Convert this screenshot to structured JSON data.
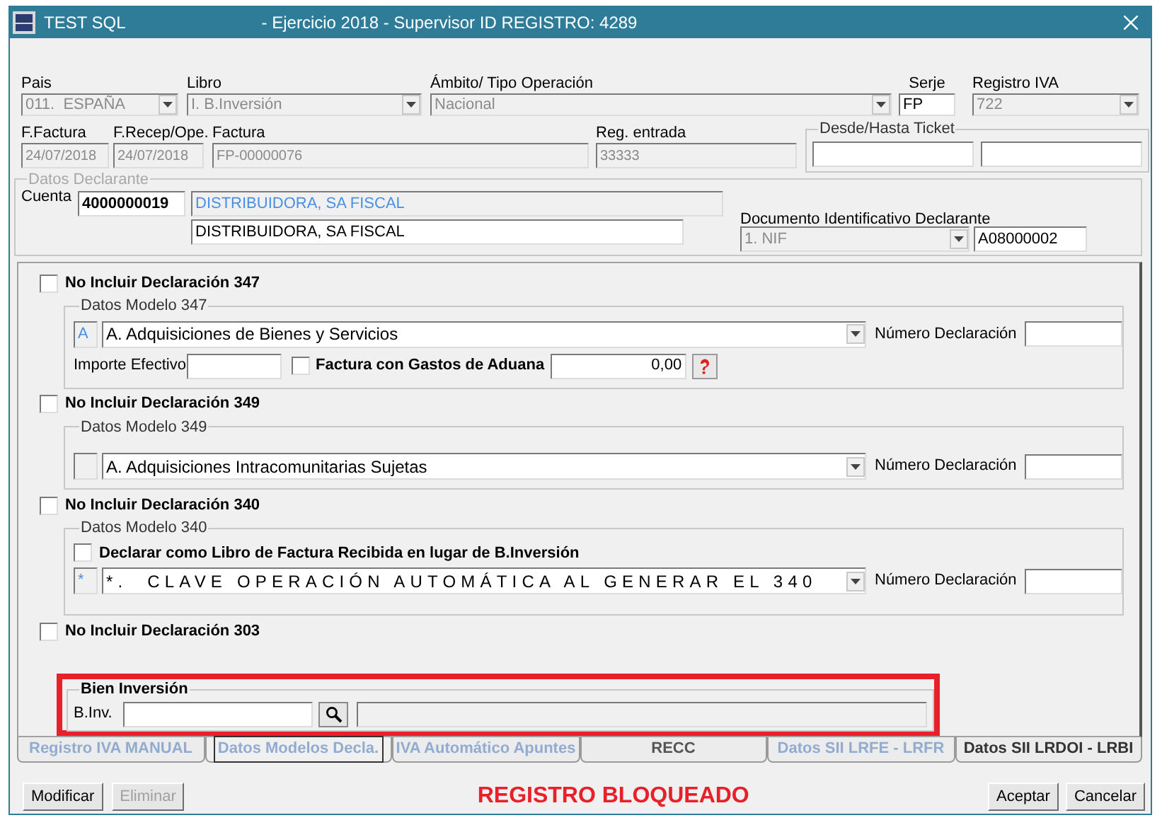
{
  "window": {
    "title": "TEST SQL",
    "subtitle": "- Ejercicio 2018 - Supervisor ID REGISTRO: 4289"
  },
  "row_1": [
    {
      "label": "Pais",
      "value": "011.  ESPAÑA",
      "kind": "combo",
      "disabled": true
    },
    {
      "label": "Libro",
      "value": "I. B.Inversión",
      "kind": "combo",
      "disabled": true
    },
    {
      "label": "Ámbito/ Tipo Operación",
      "value": "Nacional",
      "kind": "combo",
      "disabled": true
    },
    {
      "label": "Serje",
      "value": "FP",
      "kind": "text",
      "disabled": false
    },
    {
      "label": "Registro IVA",
      "value": "722",
      "kind": "combo",
      "disabled": true
    }
  ],
  "row_2": [
    {
      "label": "F.Factura",
      "value": "24/07/2018",
      "disabled": true
    },
    {
      "label": "F.Recep/Ope.",
      "value": "24/07/2018",
      "disabled": true
    },
    {
      "label": "Factura",
      "value": "FP-00000076",
      "disabled": true
    },
    {
      "label": "Reg. entrada",
      "value": "33333",
      "disabled": true
    }
  ],
  "ticket": {
    "title": "Desde/Hasta Ticket"
  },
  "declarante": {
    "title": "Datos Declarante",
    "cuenta_label": "Cuenta",
    "cuenta": "4000000019",
    "name_linked": "DISTRIBUIDORA, SA FISCAL",
    "name": "DISTRIBUIDORA, SA FISCAL",
    "doc_label": "Documento Identificativo Declarante",
    "doc_type": "1. NIF",
    "doc_number": "A08000002"
  },
  "declarations": [
    {
      "label": "No Incluir Declaración 347",
      "checked": false,
      "group": {
        "title": "Datos Modelo 347",
        "code": "A",
        "option": "A. Adquisiciones de Bienes y Servicios",
        "spaced": false,
        "number_label": "Número Declaración",
        "importe_label": "Importe Efectivo",
        "aduana": {
          "label": "Factura con Gastos de Aduana",
          "checked": false
        },
        "amount": "0,00"
      }
    },
    {
      "label": "No Incluir Declaración 349",
      "checked": false,
      "group": {
        "title": "Datos Modelo 349",
        "option": "A. Adquisiciones Intracomunitarias Sujetas",
        "spaced": false,
        "number_label": "Número Declaración"
      }
    },
    {
      "label": "No Incluir Declaración 340",
      "checked": false,
      "group": {
        "title": "Datos Modelo 340",
        "declarar": {
          "label": "Declarar como Libro de Factura Recibida en lugar de B.Inversión",
          "checked": false
        },
        "code": "*",
        "option": "*.  CLAVE OPERACIÓN AUTOMÁTICA AL GENERAR EL 340",
        "spaced": true,
        "number_label": "Número Declaración"
      }
    },
    {
      "label": "No Incluir Declaración 303",
      "checked": false
    }
  ],
  "bien_inversion": {
    "title": "Bien Inversión",
    "label": "B.Inv."
  },
  "tabs": [
    {
      "label": "Registro IVA MANUAL",
      "selected": false,
      "color": "#92acd0"
    },
    {
      "label": "Datos Modelos Decla.",
      "selected": true,
      "color": "#92acd0"
    },
    {
      "label": "IVA Automático Apuntes",
      "selected": false,
      "color": "#92acd0"
    },
    {
      "label": "RECC",
      "selected": false,
      "color": "#555555"
    },
    {
      "label": "Datos SII  LRFE - LRFR",
      "selected": false,
      "color": "#92acd0"
    },
    {
      "label": "Datos SII LRDOI - LRBI",
      "selected": false,
      "color": "#333333"
    }
  ],
  "buttons_left": [
    {
      "label": "Modificar",
      "disabled": false
    },
    {
      "label": "Eliminar",
      "disabled": true
    }
  ],
  "status": "REGISTRO BLOQUEADO",
  "buttons_right": [
    {
      "label": "Aceptar",
      "disabled": false
    },
    {
      "label": "Cancelar",
      "disabled": false
    }
  ]
}
